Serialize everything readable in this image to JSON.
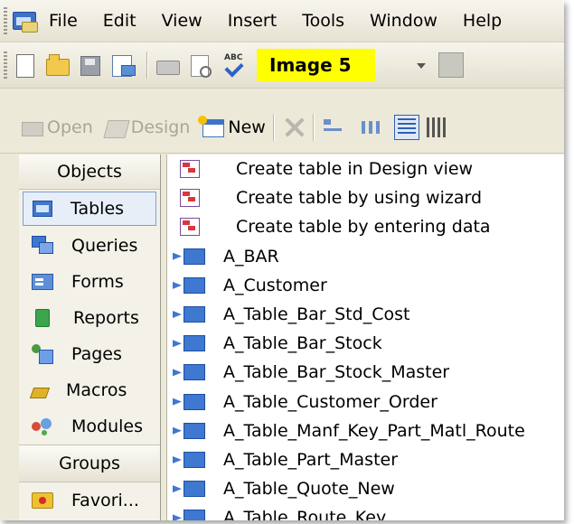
{
  "menubar": {
    "items": [
      "File",
      "Edit",
      "View",
      "Insert",
      "Tools",
      "Window",
      "Help"
    ],
    "icon": "access-app-icon"
  },
  "toolbar1": {
    "label": "Image 5",
    "label_color": "#ffff00",
    "icons": [
      "new-icon",
      "open-icon",
      "save-icon",
      "properties-icon",
      "print-icon",
      "print-preview-icon",
      "spelling-icon"
    ]
  },
  "toolbar2": {
    "open_label": "Open",
    "design_label": "Design",
    "new_label": "New"
  },
  "objects": {
    "header": "Objects",
    "items": [
      "Tables",
      "Queries",
      "Forms",
      "Reports",
      "Pages",
      "Macros",
      "Modules"
    ],
    "selected": "Tables",
    "groups_header": "Groups",
    "groups": [
      "Favori..."
    ]
  },
  "list": {
    "wizards": [
      "Create table in Design view",
      "Create table by using wizard",
      "Create table by entering data"
    ],
    "tables": [
      "A_BAR",
      "A_Customer",
      "A_Table_Bar_Std_Cost",
      "A_Table_Bar_Stock",
      "A_Table_Bar_Stock_Master",
      "A_Table_Customer_Order",
      "A_Table_Manf_Key_Part_Matl_Route",
      "A_Table_Part_Master",
      "A_Table_Quote_New",
      "A_Table_Route_Key"
    ]
  },
  "colors": {
    "chrome": "#ece9d8",
    "selection": "#7a9fd6",
    "label_bg": "#ffff00"
  }
}
